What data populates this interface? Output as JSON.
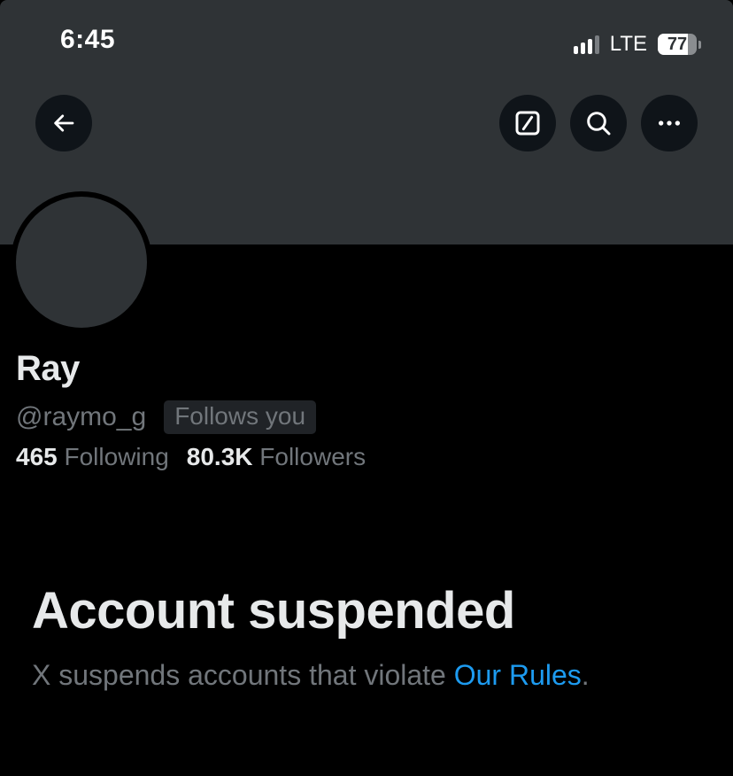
{
  "status_bar": {
    "time": "6:45",
    "network": "LTE",
    "battery_percent": "77",
    "battery_level": 0.77,
    "signal_bars_active": 3
  },
  "header": {
    "back_icon": "arrow-left-icon",
    "grok_icon": "grok-slash-icon",
    "search_icon": "search-icon",
    "more_icon": "more-horizontal-icon"
  },
  "profile": {
    "display_name": "Ray",
    "handle": "@raymo_g",
    "follows_you_badge": "Follows you",
    "following_count": "465",
    "following_label": "Following",
    "followers_count": "80.3K",
    "followers_label": "Followers"
  },
  "suspension": {
    "title": "Account suspended",
    "message_prefix": "X suspends accounts that violate ",
    "rules_link": "Our Rules",
    "message_suffix": "."
  },
  "colors": {
    "background": "#000000",
    "banner": "#2f3336",
    "primary_text": "#e7e9ea",
    "secondary_text": "#71767b",
    "link": "#1d9bf0"
  }
}
